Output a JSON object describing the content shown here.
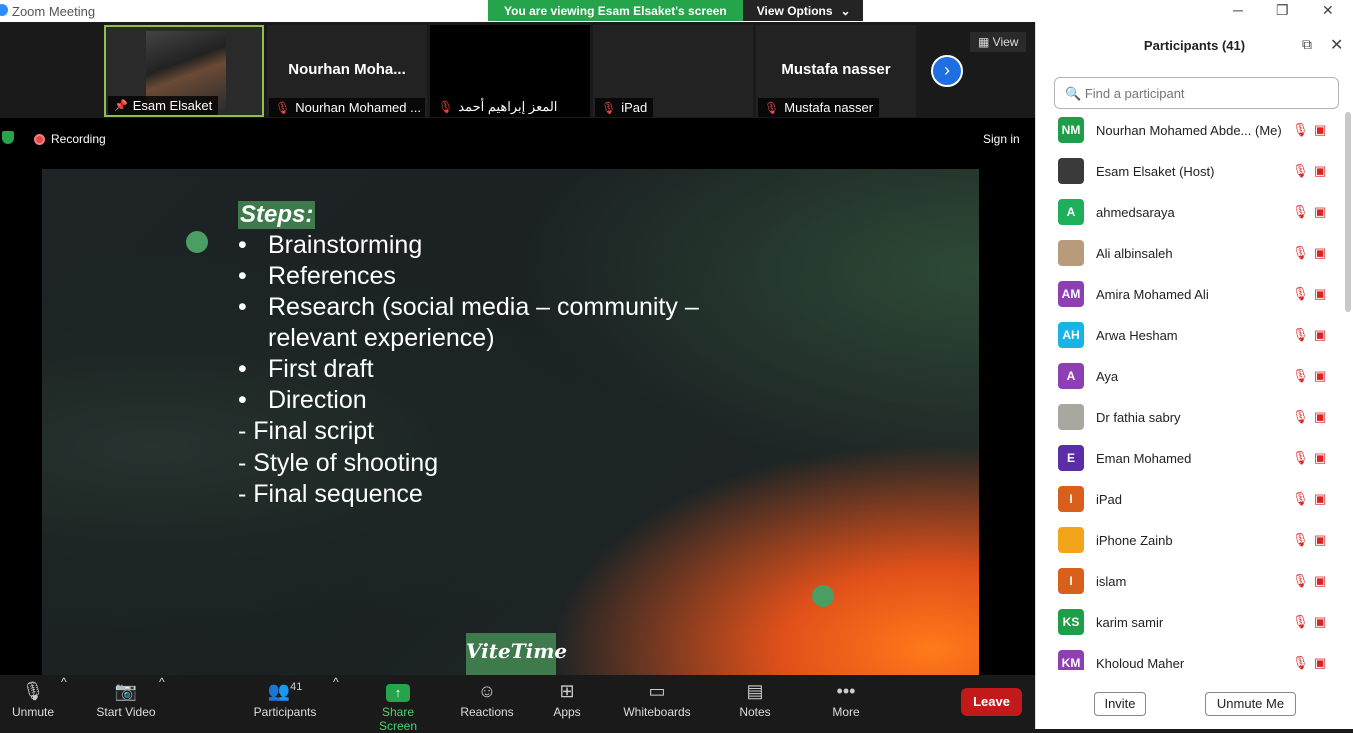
{
  "window": {
    "title": "Zoom Meeting"
  },
  "banner": {
    "viewing_text": "You are viewing Esam Elsaket's screen",
    "view_options": "View Options"
  },
  "thumbnails": [
    {
      "name": "Esam Elsaket",
      "big_name": "",
      "active": true
    },
    {
      "name": "Nourhan Mohamed ...",
      "big_name": "Nourhan  Moha..."
    },
    {
      "name": "المعز إبراهيم أحمد",
      "big_name": ""
    },
    {
      "name": "iPad",
      "big_name": ""
    },
    {
      "name": "Mustafa nasser",
      "big_name": "Mustafa nasser"
    }
  ],
  "view_button": "View",
  "recording_label": "Recording",
  "sign_in": "Sign in",
  "slide": {
    "title": "Steps:",
    "bullets": [
      "Brainstorming",
      "References",
      "Research (social media – community –",
      "relevant experience)",
      "First draft",
      "Direction"
    ],
    "dash_items": [
      "- Final script",
      "- Style of shooting",
      "- Final sequence"
    ],
    "logo": "ViteTime"
  },
  "toolbar": {
    "unmute": "Unmute",
    "start_video": "Start Video",
    "participants": "Participants",
    "participants_count": "41",
    "share_screen": "Share Screen",
    "reactions": "Reactions",
    "apps": "Apps",
    "whiteboards": "Whiteboards",
    "notes": "Notes",
    "more": "More",
    "leave": "Leave"
  },
  "panel": {
    "title": "Participants (41)",
    "search_placeholder": "Find a participant",
    "invite": "Invite",
    "unmute_me": "Unmute Me",
    "participants": [
      {
        "initials": "NM",
        "name": "Nourhan Mohamed Abde... (Me)",
        "color": "#1f9e4a"
      },
      {
        "initials": "",
        "name": "Esam Elsaket (Host)",
        "color": "#3a3a3a"
      },
      {
        "initials": "A",
        "name": "ahmedsaraya",
        "color": "#1fae5a"
      },
      {
        "initials": "",
        "name": "Ali albinsaleh",
        "color": "#b89b7a"
      },
      {
        "initials": "AM",
        "name": "Amira Mohamed Ali",
        "color": "#8e3fb4"
      },
      {
        "initials": "AH",
        "name": "Arwa Hesham",
        "color": "#19b3e6"
      },
      {
        "initials": "A",
        "name": "Aya",
        "color": "#8e3fb4"
      },
      {
        "initials": "",
        "name": "Dr fathia sabry",
        "color": "#a8a8a0"
      },
      {
        "initials": "E",
        "name": "Eman Mohamed",
        "color": "#5b2da8"
      },
      {
        "initials": "I",
        "name": "iPad",
        "color": "#d9601a"
      },
      {
        "initials": "",
        "name": "iPhone Zainb",
        "color": "#f2a41a"
      },
      {
        "initials": "I",
        "name": "islam",
        "color": "#d9601a"
      },
      {
        "initials": "KS",
        "name": "karim samir",
        "color": "#1f9e4a"
      },
      {
        "initials": "KM",
        "name": "Kholoud Maher",
        "color": "#8e3fb4"
      }
    ]
  }
}
